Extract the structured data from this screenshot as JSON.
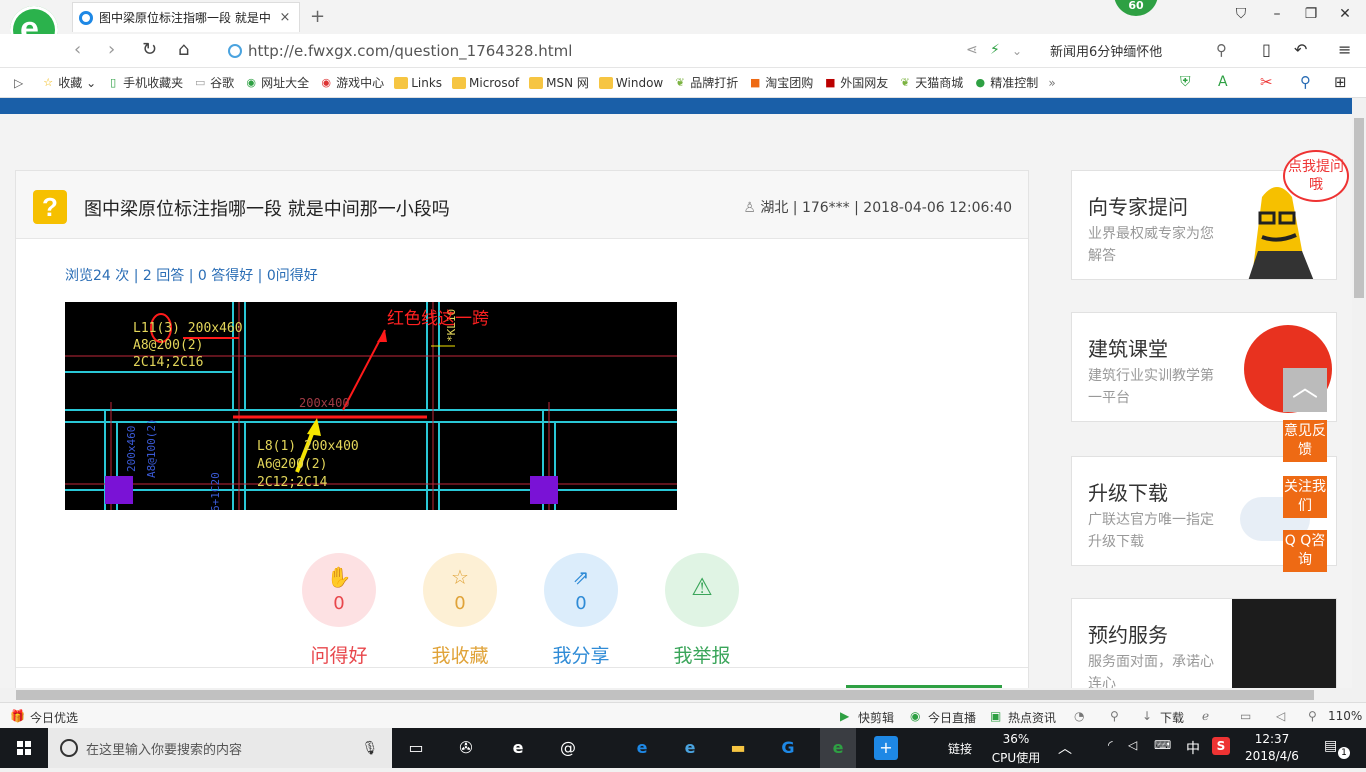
{
  "browser": {
    "tab_title": "图中梁原位标注指哪一段 就是中",
    "tab_close": "×",
    "new_tab": "+",
    "badge": "60",
    "url": "http://e.fwxgx.com/question_1764328.html",
    "news_ticker": "新闻用6分钟缅怀他"
  },
  "bookmarks": [
    {
      "label": "收藏"
    },
    {
      "label": "手机收藏夹"
    },
    {
      "label": "谷歌"
    },
    {
      "label": "网址大全"
    },
    {
      "label": "游戏中心"
    },
    {
      "label": "Links"
    },
    {
      "label": "Microsof"
    },
    {
      "label": "MSN 网"
    },
    {
      "label": "Window"
    },
    {
      "label": "品牌打折"
    },
    {
      "label": "淘宝团购"
    },
    {
      "label": "外国网友"
    },
    {
      "label": "天猫商城"
    },
    {
      "label": "精准控制"
    }
  ],
  "question": {
    "title": "图中梁原位标注指哪一段 就是中间那一小段吗",
    "meta": "湖北 | 176*** | 2018-04-06 12:06:40",
    "stats": "浏览24 次 | 2 回答 | 0 答得好 | 0问得好",
    "image": {
      "annotation": "红色线这一跨",
      "beam_top": [
        "L11(3) 200x460",
        "A8@200(2)",
        "2C14;2C16"
      ],
      "beam_mid": "200x400",
      "beam_bottom": [
        "L8(1) 200x400",
        "A6@200(2)",
        "2C12;2C14"
      ],
      "vert_left": "200x460",
      "vert_left2": "A8@100(2)",
      "vert_right": "*KL10",
      "vert_bottom": "6+1C20"
    }
  },
  "actions": [
    {
      "label": "问得好",
      "count": "0",
      "icon": "thumbs-up",
      "color": "#e8474c",
      "bg": "#fde1e3"
    },
    {
      "label": "我收藏",
      "count": "0",
      "icon": "star",
      "color": "#e0a339",
      "bg": "#fdf0d5"
    },
    {
      "label": "我分享",
      "count": "0",
      "icon": "share",
      "color": "#2f8bd6",
      "bg": "#dcedfb"
    },
    {
      "label": "我举报",
      "count": "",
      "icon": "warning",
      "color": "#3aa55a",
      "bg": "#e0f4e4"
    }
  ],
  "sidebar": [
    {
      "title": "向专家提问",
      "desc": "业界最权威专家为您解答"
    },
    {
      "title": "建筑课堂",
      "desc": "建筑行业实训教学第一平台"
    },
    {
      "title": "升级下载",
      "desc": "广联达官方唯一指定升级下载"
    },
    {
      "title": "预约服务",
      "desc": "服务面对面，承诺心连心"
    }
  ],
  "floating": {
    "ask_bubble": "点我提问哦",
    "feedback": "意见反馈",
    "follow": "关注我们",
    "qq": "Q Q咨询"
  },
  "statusbar": {
    "left": "今日优选",
    "items": [
      "快剪辑",
      "今日直播",
      "热点资讯",
      "下载"
    ],
    "zoom": "110%"
  },
  "taskbar": {
    "search_placeholder": "在这里输入你要搜索的内容",
    "link": "链接",
    "cpu_pct": "36%",
    "cpu_label": "CPU使用",
    "ime": "中",
    "time": "12:37",
    "date": "2018/4/6",
    "notif": "1"
  },
  "colors": {
    "accent_blue": "#1a5fa8",
    "orange": "#ee6a14",
    "taskbar": "#16191d"
  }
}
